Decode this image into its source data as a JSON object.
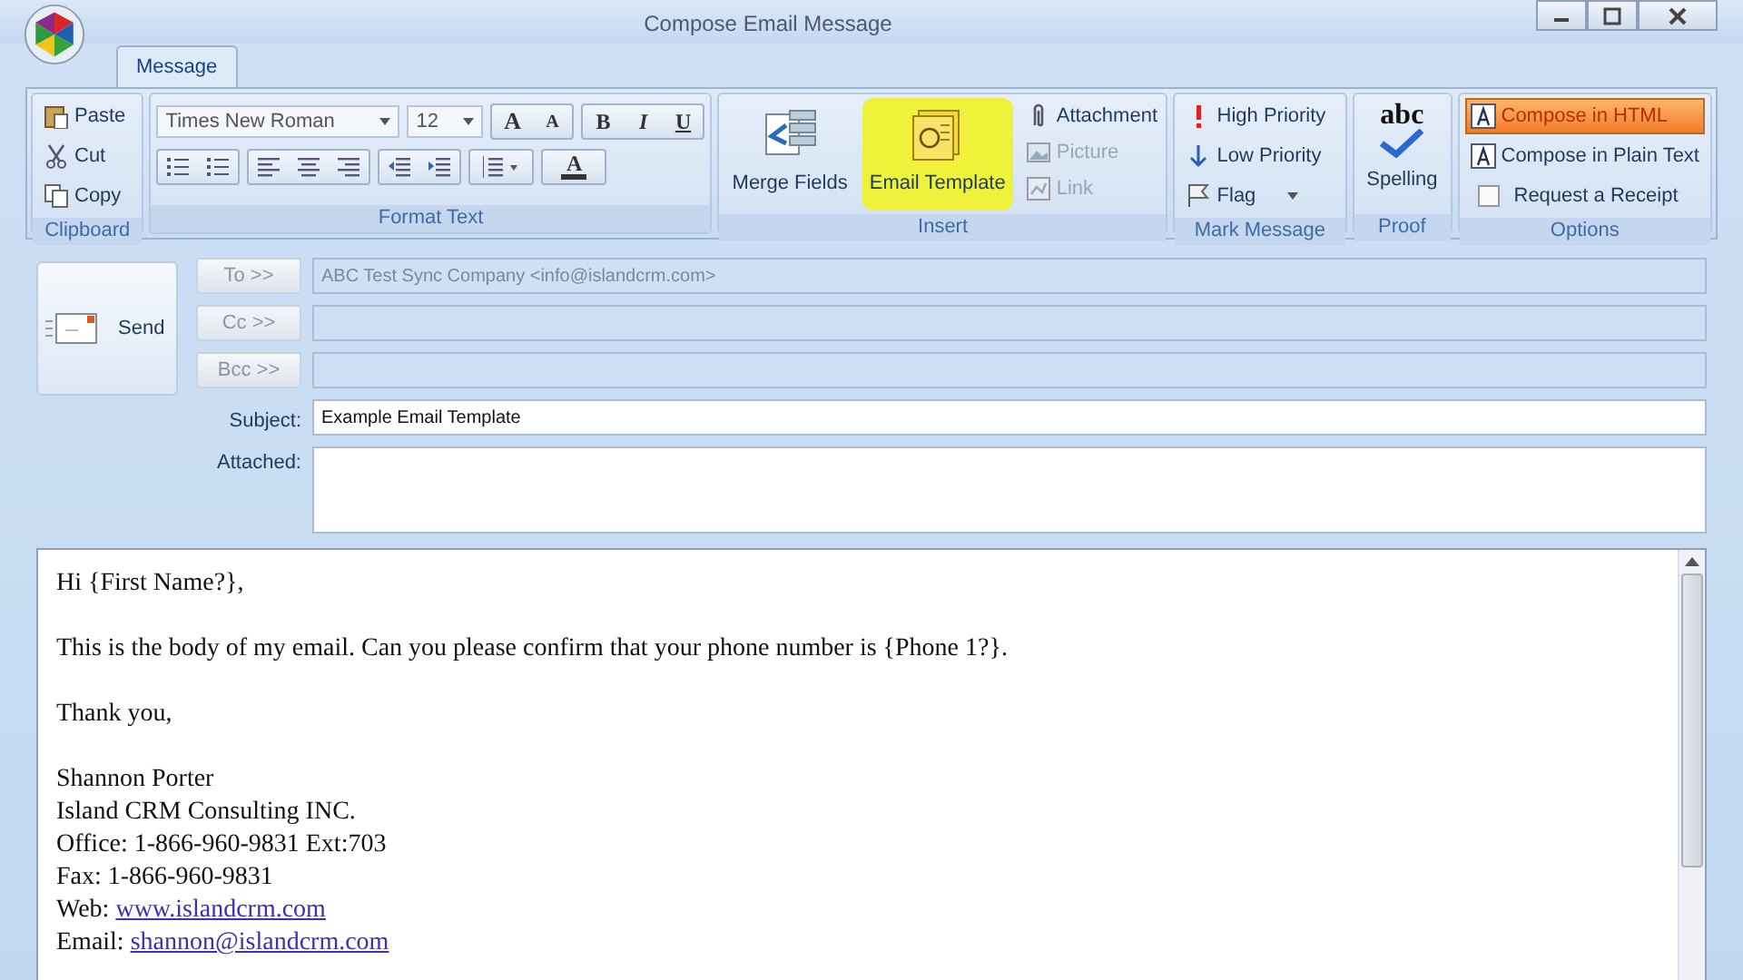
{
  "window": {
    "title": "Compose Email Message"
  },
  "tabs": [
    {
      "label": "Message",
      "selected": true
    }
  ],
  "ribbon": {
    "clipboard": {
      "label": "Clipboard",
      "items": [
        "Paste",
        "Cut",
        "Copy"
      ]
    },
    "format_text": {
      "label": "Format Text",
      "font": "Times New Roman",
      "size": "12",
      "size_buttons": [
        "A",
        "A"
      ],
      "style_buttons": [
        "B",
        "I",
        "U"
      ],
      "font_color": "A"
    },
    "insert": {
      "label": "Insert",
      "large": [
        {
          "label": "Merge Fields",
          "highlighted": false
        },
        {
          "label": "Email Template",
          "highlighted": true
        }
      ],
      "small": [
        {
          "label": "Attachment",
          "disabled": false
        },
        {
          "label": "Picture",
          "disabled": true
        },
        {
          "label": "Link",
          "disabled": true
        }
      ]
    },
    "mark_message": {
      "label": "Mark Message",
      "items": [
        "High Priority",
        "Low Priority",
        "Flag"
      ]
    },
    "proof": {
      "label": "Proof",
      "icon_text": "abc",
      "button": "Spelling"
    },
    "options": {
      "label": "Options",
      "items": [
        {
          "kind": "radio",
          "label": "Compose in HTML",
          "selected": true
        },
        {
          "kind": "radio",
          "label": "Compose in Plain Text",
          "selected": false
        },
        {
          "kind": "check",
          "label": "Request a Receipt",
          "checked": false
        }
      ]
    }
  },
  "header": {
    "send": "Send",
    "recipients": [
      {
        "button": "To >>",
        "value": "ABC Test Sync Company <info@islandcrm.com>"
      },
      {
        "button": "Cc >>"
      },
      {
        "button": "Bcc >>"
      }
    ],
    "subject": {
      "label": "Subject:",
      "value": "Example Email Template"
    },
    "attached": {
      "label": "Attached:"
    }
  },
  "body": {
    "paragraphs": [
      [
        {
          "text": "Hi {First Name?},"
        }
      ],
      [
        {
          "text": "This is the body of my email. Can you please confirm that your phone number is {Phone 1?}."
        }
      ],
      [
        {
          "text": "Thank you,"
        }
      ],
      [
        {
          "text": "Shannon Porter"
        },
        {
          "text": "Island CRM Consulting INC."
        },
        {
          "text": "Office: 1-866-960-9831 Ext:703"
        },
        {
          "text": "Fax: 1-866-960-9831"
        },
        {
          "text": "Web:",
          "link": "www.islandcrm.com"
        },
        {
          "text": "Email:",
          "link": "shannon@islandcrm.com"
        }
      ]
    ]
  }
}
